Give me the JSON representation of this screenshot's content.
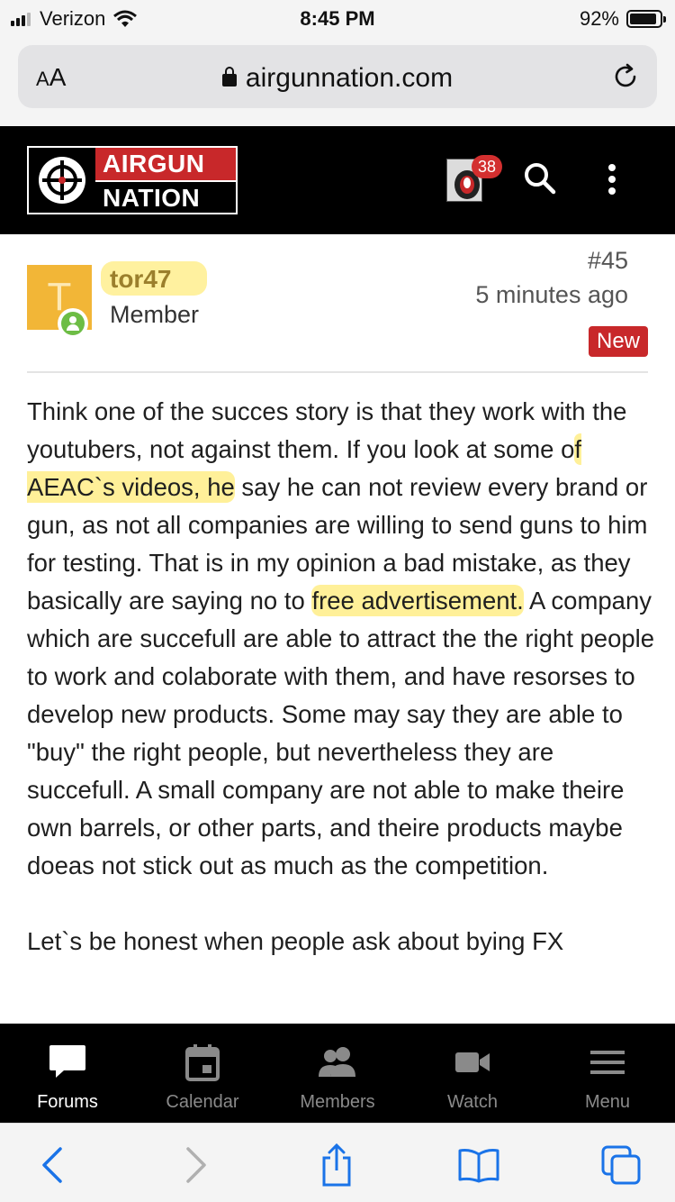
{
  "status_bar": {
    "carrier": "Verizon",
    "time": "8:45 PM",
    "battery": "92%"
  },
  "browser": {
    "aa_label_small": "A",
    "aa_label": "A",
    "url": "airgunnation.com"
  },
  "header": {
    "logo_top": "AIRGUN",
    "logo_bottom": "NATION",
    "notification_count": "38"
  },
  "post": {
    "avatar_letter": "T",
    "username": "tor47",
    "role": "Member",
    "post_number": "#45",
    "time": "5 minutes ago",
    "new_label": "New",
    "body": {
      "p1_a": "Think one of the succes story is that they work with the youtubers, not against them. If you look at some o",
      "p1_hl1": "f AEAC`s videos, he",
      "p1_b": " say he can not review every brand or gun, as not all companies are willing to send guns to him for testing. That is in my opinion a bad mistake, as they basically are saying no to ",
      "p1_hl2": "free advertisement.",
      "p1_c": " A company which are succefull are able to attract the the right people to work and colaborate with them, and have resorses to develop new products. Some may say they are able to \"buy\" the right people, but nevertheless they are succefull. A small company are not able to make theire own barrels, or other parts, and theire products maybe doeas not stick out as much as the competition.",
      "p2": "Let`s be honest when people ask about bying FX"
    }
  },
  "tabbar": {
    "tabs": [
      {
        "label": "Forums",
        "icon": "forums-icon",
        "active": true
      },
      {
        "label": "Calendar",
        "icon": "calendar-icon",
        "active": false
      },
      {
        "label": "Members",
        "icon": "members-icon",
        "active": false
      },
      {
        "label": "Watch",
        "icon": "watch-icon",
        "active": false
      },
      {
        "label": "Menu",
        "icon": "menu-icon",
        "active": false
      }
    ]
  },
  "colors": {
    "brand_red": "#c8282a",
    "highlight": "#ffe446",
    "safari_blue": "#1a73e8"
  }
}
